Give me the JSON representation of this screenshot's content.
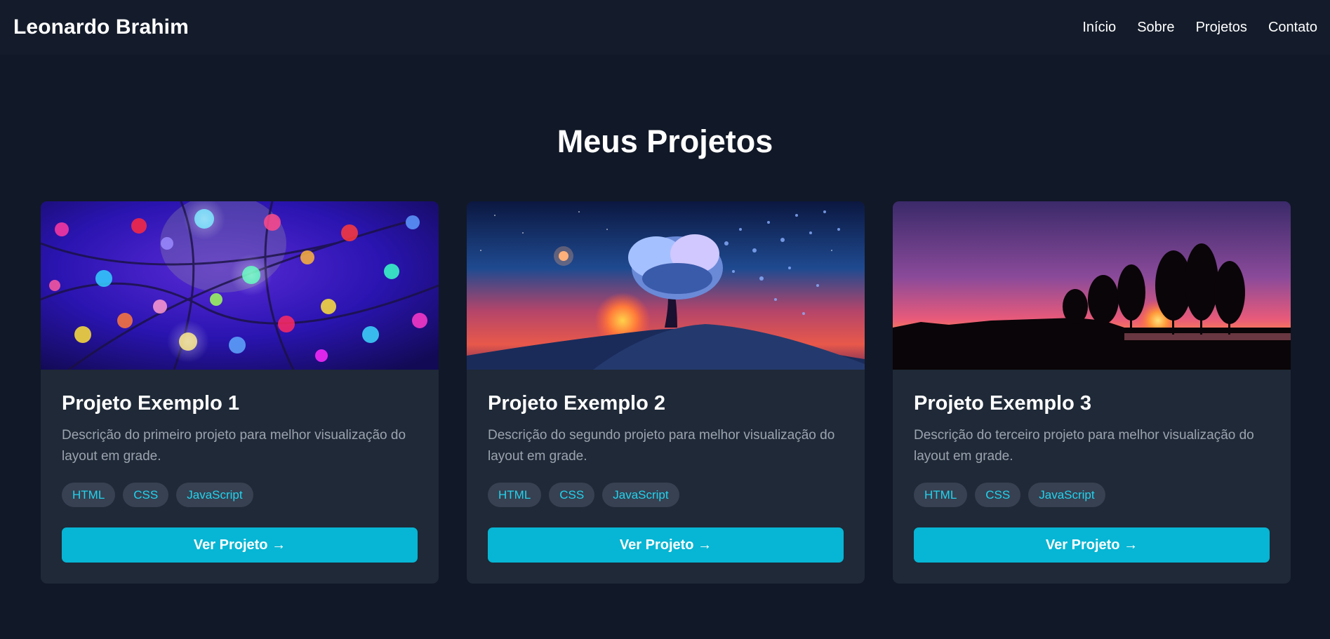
{
  "header": {
    "brand": "Leonardo Brahim",
    "nav": [
      {
        "label": "Início"
      },
      {
        "label": "Sobre"
      },
      {
        "label": "Projetos"
      },
      {
        "label": "Contato"
      }
    ]
  },
  "main": {
    "title": "Meus Projetos",
    "projects": [
      {
        "title": "Projeto Exemplo 1",
        "description": "Descrição do primeiro projeto para melhor visualização do layout em grade.",
        "tags": [
          "HTML",
          "CSS",
          "JavaScript"
        ],
        "button_label": "Ver Projeto →"
      },
      {
        "title": "Projeto Exemplo 2",
        "description": "Descrição do segundo projeto para melhor visualização do layout em grade.",
        "tags": [
          "HTML",
          "CSS",
          "JavaScript"
        ],
        "button_label": "Ver Projeto →"
      },
      {
        "title": "Projeto Exemplo 3",
        "description": "Descrição do terceiro projeto para melhor visualização do layout em grade.",
        "tags": [
          "HTML",
          "CSS",
          "JavaScript"
        ],
        "button_label": "Ver Projeto →"
      }
    ]
  },
  "colors": {
    "background": "#111827",
    "header_background": "#141c2b",
    "card_background": "#1f2937",
    "accent": "#06b6d4",
    "tag_text": "#22d3ee",
    "tag_background": "#374151",
    "muted_text": "#9ca3af"
  }
}
